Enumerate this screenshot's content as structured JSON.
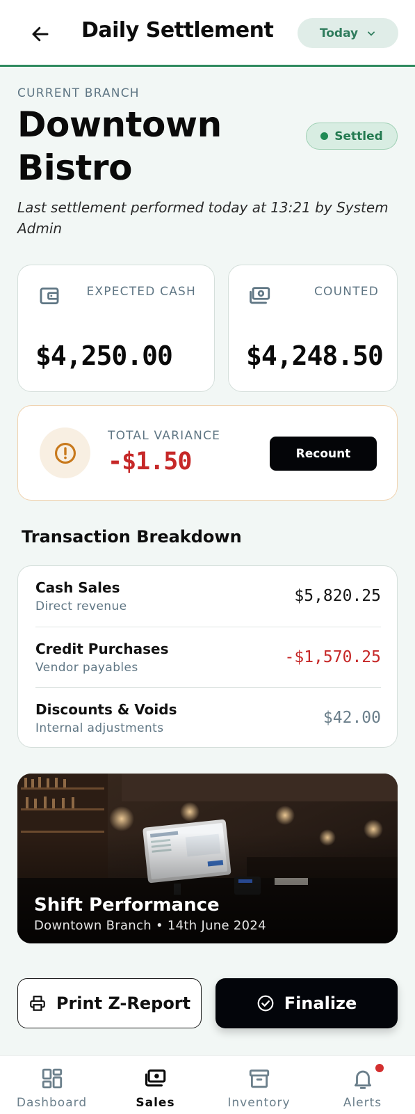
{
  "header": {
    "title": "Daily Settlement",
    "period_selector": "Today"
  },
  "branch": {
    "label": "CURRENT BRANCH",
    "name": "Downtown Bistro",
    "status": "Settled",
    "last_settlement_note": "Last settlement performed today at 13:21 by System Admin"
  },
  "cash": {
    "expected_label": "EXPECTED CASH",
    "expected_value": "$4,250.00",
    "counted_label": "COUNTED",
    "counted_value": "$4,248.50"
  },
  "variance": {
    "label": "TOTAL VARIANCE",
    "value": "-$1.50",
    "recount_label": "Recount"
  },
  "breakdown": {
    "title": "Transaction Breakdown",
    "rows": [
      {
        "title": "Cash Sales",
        "subtitle": "Direct revenue",
        "amount": "$5,820.25"
      },
      {
        "title": "Credit Purchases",
        "subtitle": "Vendor payables",
        "amount": "-$1,570.25"
      },
      {
        "title": "Discounts & Voids",
        "subtitle": "Internal adjustments",
        "amount": "$42.00"
      }
    ]
  },
  "shift": {
    "title": "Shift Performance",
    "subtitle": "Downtown Branch • 14th June 2024"
  },
  "actions": {
    "print_label": "Print Z-Report",
    "finalize_label": "Finalize"
  },
  "nav": {
    "items": [
      {
        "label": "Dashboard",
        "icon": "dashboard-icon"
      },
      {
        "label": "Sales",
        "icon": "cash-icon"
      },
      {
        "label": "Inventory",
        "icon": "archive-icon"
      },
      {
        "label": "Alerts",
        "icon": "bell-icon"
      }
    ],
    "active": "Sales"
  },
  "colors": {
    "accent_green": "#2f8a5e",
    "negative_red": "#c62828",
    "primary_black": "#03050a"
  }
}
